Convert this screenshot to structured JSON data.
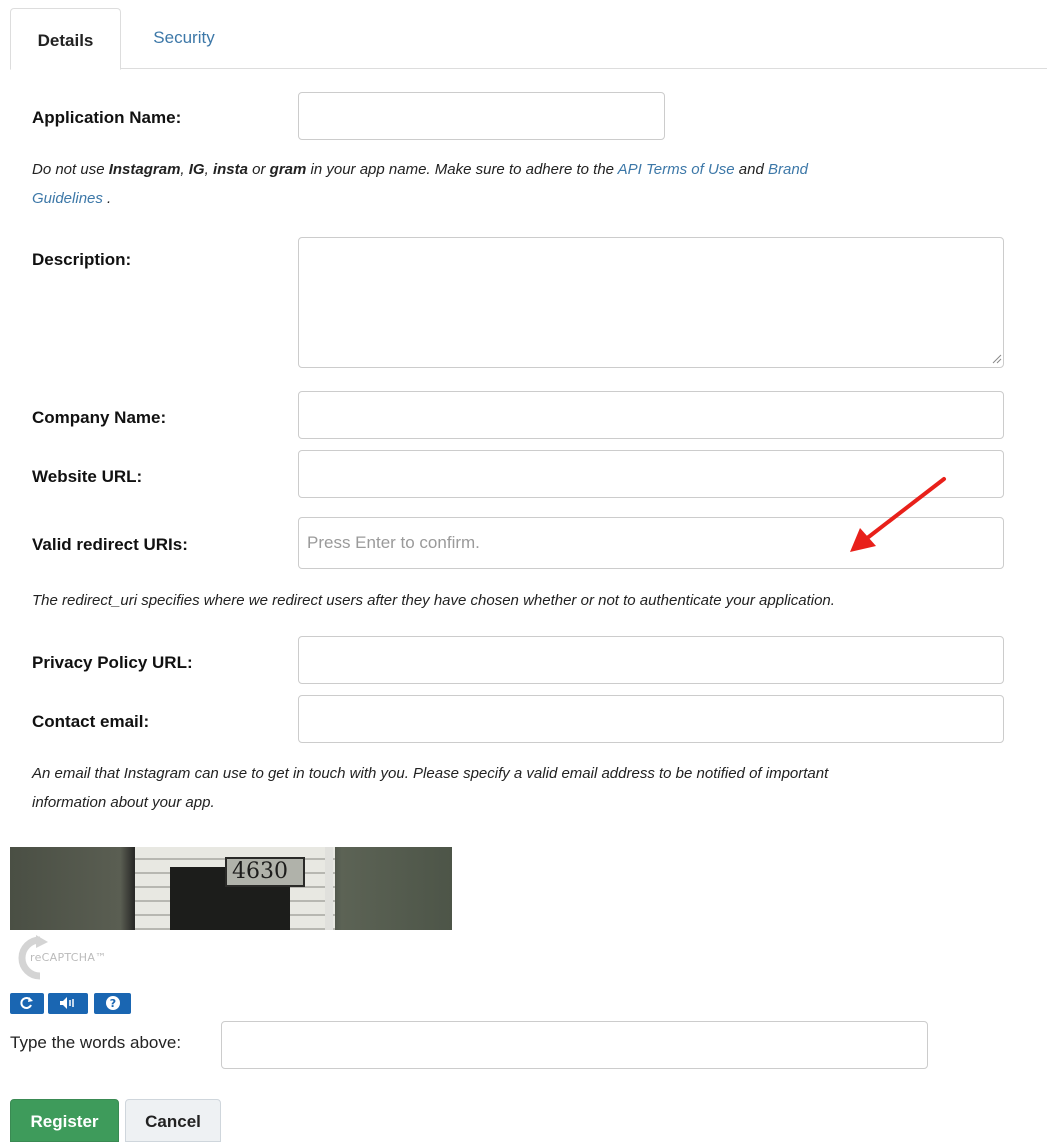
{
  "tabs": [
    {
      "label": "Details",
      "active": true
    },
    {
      "label": "Security",
      "active": false
    }
  ],
  "form": {
    "application_name": {
      "label": "Application Name:",
      "value": ""
    },
    "name_help": {
      "prefix": "Do not use ",
      "kw1": "Instagram",
      "sep1": ", ",
      "kw2": "IG",
      "sep2": ", ",
      "kw3": "insta",
      "or": " or ",
      "kw4": "gram",
      "mid": " in your app name. Make sure to adhere to the ",
      "link1": "API Terms of Use",
      "and": " and ",
      "link2a": "Brand",
      "link2b": "Guidelines",
      "suffix": " ."
    },
    "description": {
      "label": "Description:",
      "value": ""
    },
    "company_name": {
      "label": "Company Name:",
      "value": ""
    },
    "website_url": {
      "label": "Website URL:",
      "value": ""
    },
    "redirect_uris": {
      "label": "Valid redirect URIs:",
      "placeholder": "Press Enter to confirm."
    },
    "redirect_help": "The redirect_uri specifies where we redirect users after they have chosen whether or not to authenticate your application.",
    "privacy_policy_url": {
      "label": "Privacy Policy URL:",
      "value": ""
    },
    "contact_email": {
      "label": "Contact email:",
      "value": ""
    },
    "email_help_line1": "An email that Instagram can use to get in touch with you. Please specify a valid email address to be notified of important",
    "email_help_line2": "information about your app."
  },
  "captcha": {
    "image_number": "4630",
    "brand": "reCAPTCHA™",
    "buttons": [
      "refresh-icon",
      "audio-icon",
      "help-icon"
    ],
    "words_label": "Type the words above:",
    "words_value": ""
  },
  "actions": {
    "register_label": "Register",
    "cancel_label": "Cancel"
  },
  "colors": {
    "link": "#3d78a8",
    "register": "#3e9b5b",
    "annotation_arrow": "#e8201a",
    "captcha_buttons": "#1a66b2"
  }
}
